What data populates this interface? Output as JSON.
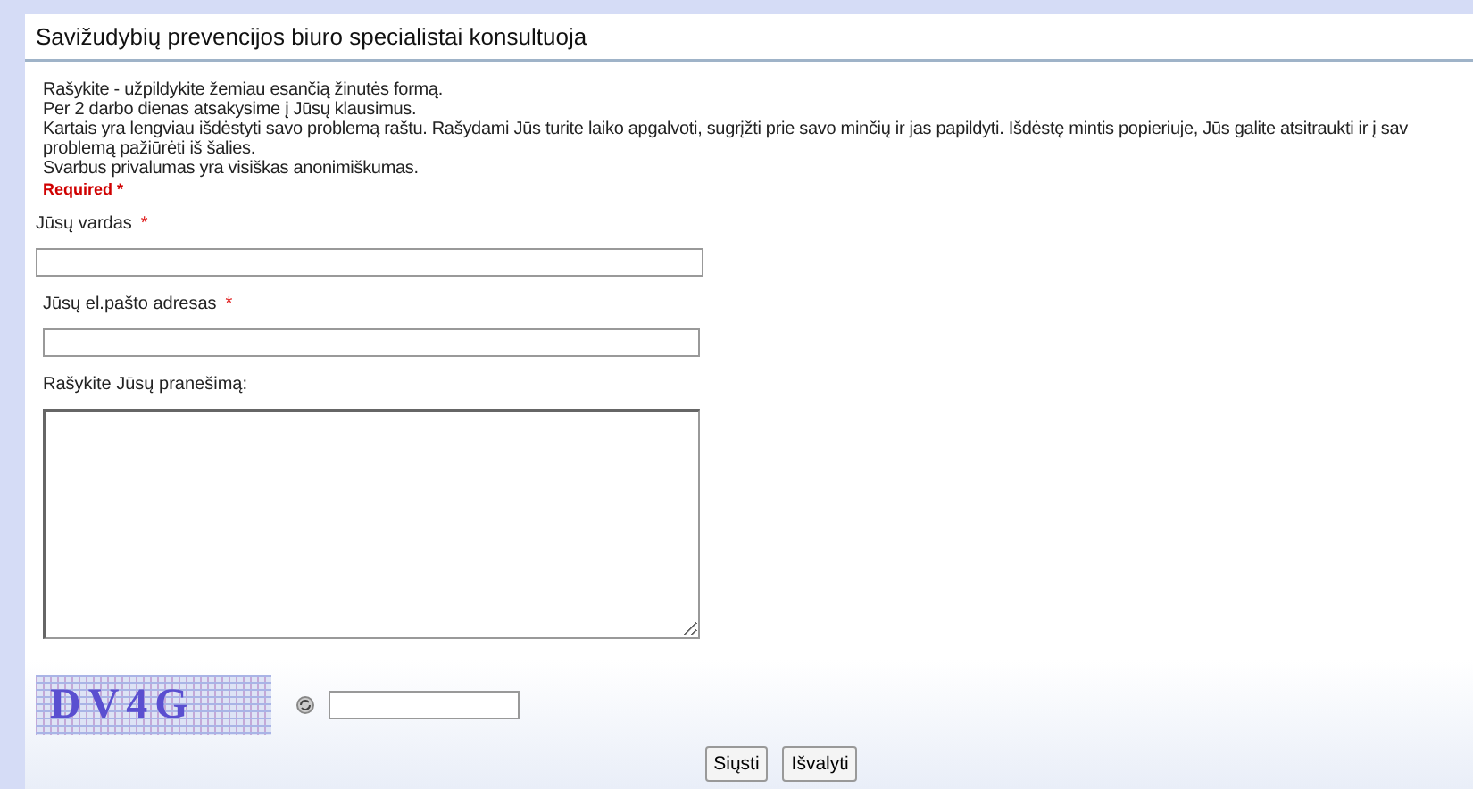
{
  "title": "Savižudybių prevencijos biuro specialistai konsultuoja",
  "intro": [
    "Rašykite - užpildykite žemiau esančią žinutės formą.",
    "Per 2 darbo dienas atsakysime į Jūsų klausimus.",
    "Kartais yra lengviau išdėstyti savo problemą raštu. Rašydami Jūs turite laiko apgalvoti, sugrįžti prie savo minčių ir jas papildyti. Išdėstę mintis popieriuje, Jūs galite atsitraukti ir į sav",
    "problemą pažiūrėti iš šalies.",
    "Svarbus privalumas yra visiškas anonimiškumas."
  ],
  "required_note": {
    "text": "Required",
    "mark": "*"
  },
  "fields": [
    {
      "kind": "input",
      "label": "Jūsų vardas",
      "required": true
    },
    {
      "kind": "input",
      "label": "Jūsų el.pašto adresas",
      "required": true
    },
    {
      "kind": "textarea",
      "label": "Rašykite Jūsų pranešimą:",
      "required": false
    }
  ],
  "captcha": {
    "text": "DV4G"
  },
  "buttons": [
    "Siųsti",
    "Išvalyti"
  ]
}
